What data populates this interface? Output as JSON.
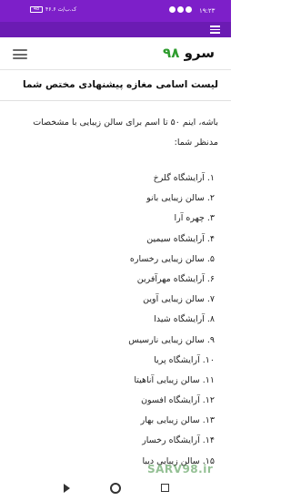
{
  "status_bar": {
    "time": "۱۹:۲۳",
    "battery": "48",
    "speed": "۴۶.۶ ک.ب/ث"
  },
  "header": {
    "logo_text": "سرو",
    "logo_number": "۹۸"
  },
  "article": {
    "title": "لیست اسامی مغازه پیشنهادی مختص شما",
    "intro": "باشه، اینم ۵۰ تا اسم برای سالن زیبایی با مشخصات مدنظر شما:",
    "items": [
      "۱. آرایشگاه گلرخ",
      "۲. سالن زیبایی بانو",
      "۳. چهره آرا",
      "۴. آرایشگاه سیمین",
      "۵. سالن زیبایی رخساره",
      "۶. آرایشگاه مهرآفرین",
      "۷. سالن زیبایی آوین",
      "۸. آرایشگاه شیدا",
      "۹. سالن زیبایی نارسیس",
      "۱۰. آرایشگاه پریا",
      "۱۱. سالن زیبایی آناهیتا",
      "۱۲. آرایشگاه افسون",
      "۱۳. سالن زیبایی بهار",
      "۱۴. آرایشگاه رخسار",
      "۱۵. سالن زیبایی دیبا"
    ]
  },
  "watermark": "SARV98.ir",
  "colors": {
    "status_bar": "#7d1fc9",
    "header_strip": "#6b1bb3",
    "logo_number": "#2e9c2e"
  }
}
